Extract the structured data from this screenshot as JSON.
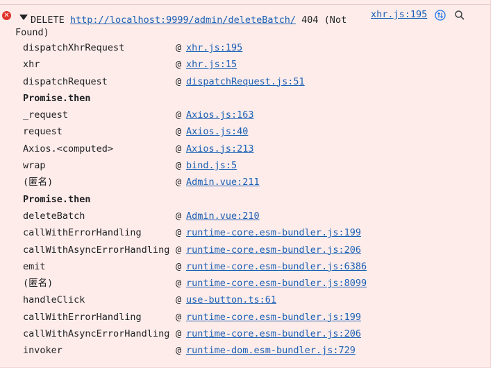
{
  "error": {
    "method": "DELETE",
    "url": "http://localhost:9999/admin/deleteBatch/",
    "status": "404 (Not",
    "status_cont": "Found)",
    "source": "xhr.js:195",
    "icons": {
      "error": "error-icon",
      "expand": "disclosure-triangle-icon",
      "network": "network-request-icon",
      "search": "search-icon"
    },
    "colors": {
      "background": "#fdecea",
      "link": "#1a5fb4",
      "error": "#e0342b"
    }
  },
  "stack": [
    {
      "fn": "dispatchXhrRequest",
      "at": "@",
      "link": "xhr.js:195"
    },
    {
      "fn": "xhr",
      "at": "@",
      "link": "xhr.js:15"
    },
    {
      "fn": "dispatchRequest",
      "at": "@",
      "link": "dispatchRequest.js:51"
    },
    {
      "fn": "Promise.then",
      "at": "",
      "link": "",
      "separator": true
    },
    {
      "fn": "_request",
      "at": "@",
      "link": "Axios.js:163"
    },
    {
      "fn": "request",
      "at": "@",
      "link": "Axios.js:40"
    },
    {
      "fn": "Axios.<computed>",
      "at": "@",
      "link": "Axios.js:213"
    },
    {
      "fn": "wrap",
      "at": "@",
      "link": "bind.js:5"
    },
    {
      "fn": "(匿名)",
      "at": "@",
      "link": "Admin.vue:211"
    },
    {
      "fn": "Promise.then",
      "at": "",
      "link": "",
      "separator": true
    },
    {
      "fn": "deleteBatch",
      "at": "@",
      "link": "Admin.vue:210"
    },
    {
      "fn": "callWithErrorHandling",
      "at": "@",
      "link": "runtime-core.esm-bundler.js:199"
    },
    {
      "fn": "callWithAsyncErrorHandling",
      "at": "@",
      "link": "runtime-core.esm-bundler.js:206"
    },
    {
      "fn": "emit",
      "at": "@",
      "link": "runtime-core.esm-bundler.js:6386"
    },
    {
      "fn": "(匿名)",
      "at": "@",
      "link": "runtime-core.esm-bundler.js:8099"
    },
    {
      "fn": "handleClick",
      "at": "@",
      "link": "use-button.ts:61"
    },
    {
      "fn": "callWithErrorHandling",
      "at": "@",
      "link": "runtime-core.esm-bundler.js:199"
    },
    {
      "fn": "callWithAsyncErrorHandling",
      "at": "@",
      "link": "runtime-core.esm-bundler.js:206"
    },
    {
      "fn": "invoker",
      "at": "@",
      "link": "runtime-dom.esm-bundler.js:729"
    }
  ]
}
